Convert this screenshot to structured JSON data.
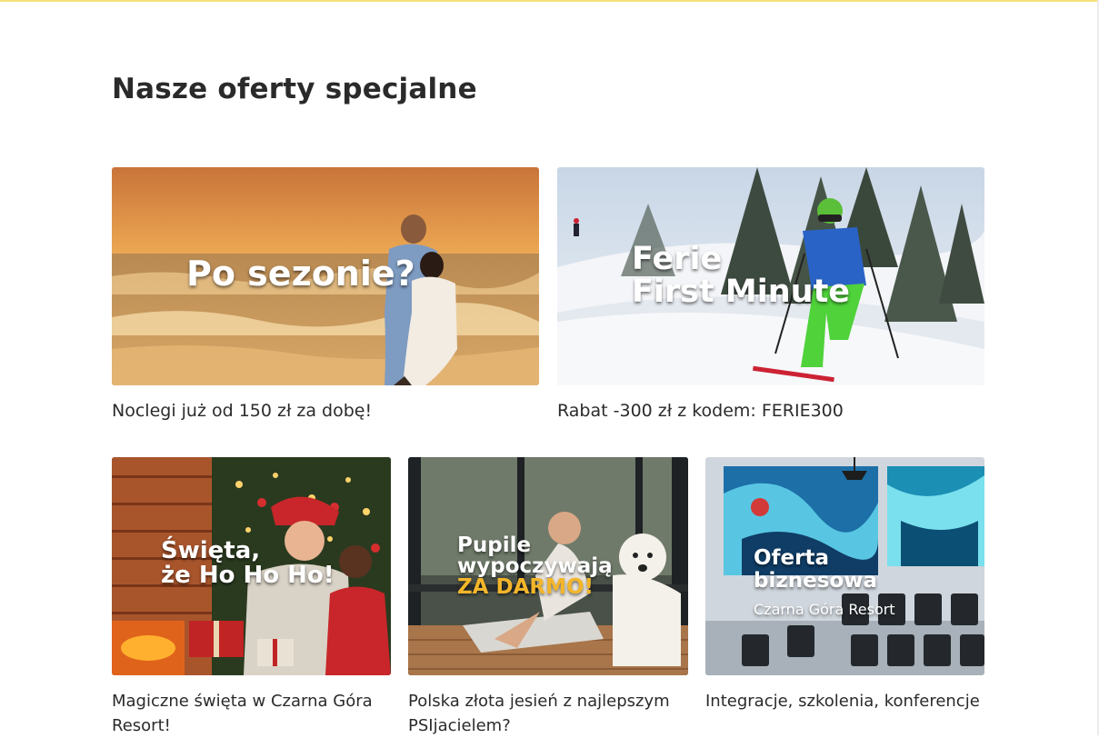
{
  "section": {
    "title": "Nasze oferty specjalne"
  },
  "offers": [
    {
      "overlay_line1": "Po sezonie?",
      "caption": "Noclegi już od 150 zł za dobę!"
    },
    {
      "overlay_line1": "Ferie",
      "overlay_line2": "First Minute",
      "caption": "Rabat -300 zł z kodem: FERIE300"
    },
    {
      "overlay_line1": "Święta,",
      "overlay_line2": "że Ho Ho Ho!",
      "caption": "Magiczne święta w Czarna Góra Resort!"
    },
    {
      "overlay_line1": "Pupile",
      "overlay_line2": "wypoczywają",
      "overlay_line3": "ZA DARMO!",
      "caption": "Polska złota jesień z najlepszym PSIjacielem?"
    },
    {
      "overlay_line1": "Oferta",
      "overlay_line2": "biznesowa",
      "overlay_line3": "Czarna Góra Resort",
      "caption": "Integracje, szkolenia, konferencje"
    }
  ],
  "colors": {
    "top_rule": "#f3e27a",
    "accent": "#f3b62a",
    "text": "#2b2b2b"
  }
}
